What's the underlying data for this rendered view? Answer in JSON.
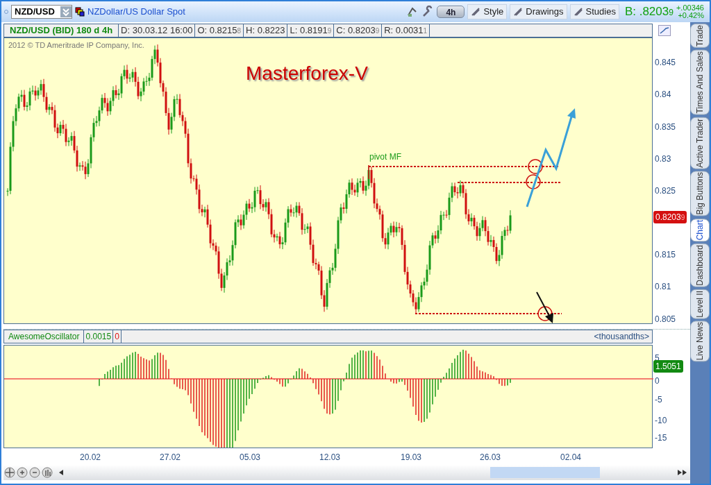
{
  "toolbar": {
    "symbol": "NZD/USD",
    "description": "NZDollar/US Dollar Spot",
    "aggregation": "4h",
    "buttons": [
      "Style",
      "Drawings",
      "Studies"
    ],
    "bid": {
      "label": "B: .8203",
      "pip": "9"
    },
    "change": "+.00346",
    "change_percent": "+0.42%"
  },
  "info_bar": {
    "title": "NZD/USD (BID) 180 d 4h",
    "fields": [
      {
        "label": "D: 30.03.12 16:00"
      },
      {
        "label": "O: 0.8215",
        "pip": "8"
      },
      {
        "label": "H: 0.8223"
      },
      {
        "label": "L: 0.8191",
        "pip": "9"
      },
      {
        "label": "C: 0.8203",
        "pip": "9"
      },
      {
        "label": "R: 0.0031",
        "pip": "1"
      }
    ]
  },
  "chart": {
    "copyright": "2012 © TD Ameritrade IP Company, Inc.",
    "title": "Masterforex-V",
    "pivot_label": "pivot MF",
    "price_axis": [
      "0.845",
      "0.84",
      "0.835",
      "0.83",
      "0.825",
      "0.815",
      "0.81",
      "0.805"
    ],
    "last_price": {
      "value": "0.8203",
      "pip": "9"
    }
  },
  "oscillator": {
    "name": "AwesomeOscillator",
    "value": "0.0015",
    "zero": "0",
    "units": "<thousandths>",
    "axis": [
      "5",
      "0",
      "-5",
      "-10",
      "-15"
    ],
    "last_value": "1.5051"
  },
  "date_axis": [
    "20.02",
    "27.02",
    "05.03",
    "12.03",
    "19.03",
    "26.03",
    "02.04"
  ],
  "side_tabs": [
    {
      "label": "Trade",
      "selected": false
    },
    {
      "label": "Times And Sales",
      "selected": false
    },
    {
      "label": "Active Trader",
      "selected": false
    },
    {
      "label": "Big Buttons",
      "selected": false
    },
    {
      "label": "Chart",
      "selected": true
    },
    {
      "label": "Dashboard",
      "selected": false
    },
    {
      "label": "Level II",
      "selected": false
    },
    {
      "label": "Live News",
      "selected": false
    }
  ]
}
